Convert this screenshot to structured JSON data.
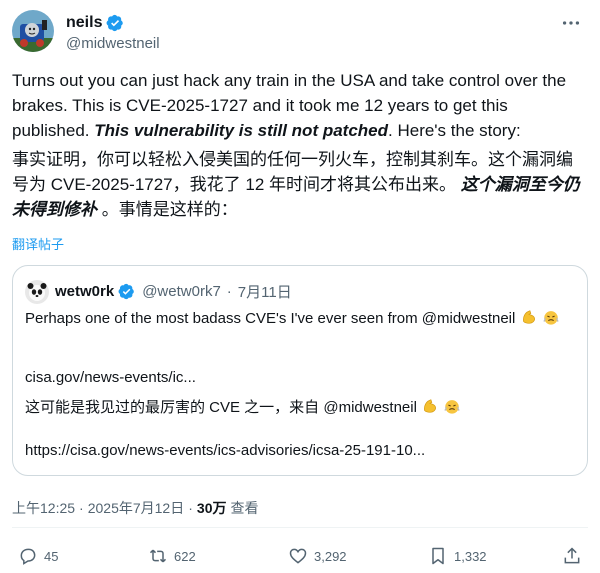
{
  "author": {
    "name": "neils",
    "handle": "@midwestneil"
  },
  "tweet": {
    "en_part1": "Turns out you can just hack any train in the USA and take control over the brakes. This is CVE-2025-1727 and it took me 12 years to get this published. ",
    "en_emph": "This vulnerability is still not patched",
    "en_part2": ". Here's the story:",
    "cn_part1": "事实证明，你可以轻松入侵美国的任何一列火车，控制其刹车。这个漏洞编号为 CVE-2025-1727，我花了 12 年时间才将其公布出来。 ",
    "cn_emph": "这个漏洞至今仍未得到修补",
    "cn_part2": " 。事情是这样的：",
    "translate_label": "翻译帖子"
  },
  "quote": {
    "name": "wetw0rk",
    "handle": "@wetw0rk7",
    "date": "7月11日",
    "separator": "·",
    "text": "Perhaps one of the most badass CVE's I've ever seen from @midwestneil",
    "link_short": "cisa.gov/news-events/ic...",
    "cn_text": "这可能是我见过的最厉害的 CVE 之一，来自 @midwestneil",
    "link_full": "https://cisa.gov/news-events/ics-advisories/icsa-25-191-10..."
  },
  "meta": {
    "time": "上午12:25",
    "sep1": "·",
    "date": "2025年7月12日",
    "sep2": "·",
    "views_count": "30万",
    "views_label": "查看"
  },
  "actions": {
    "replies": "45",
    "reposts": "622",
    "likes": "3,292",
    "bookmarks": "1,332"
  },
  "colors": {
    "accent": "#1d9bf0",
    "text": "#0f1419",
    "muted": "#536471",
    "border": "#cfd9de"
  }
}
